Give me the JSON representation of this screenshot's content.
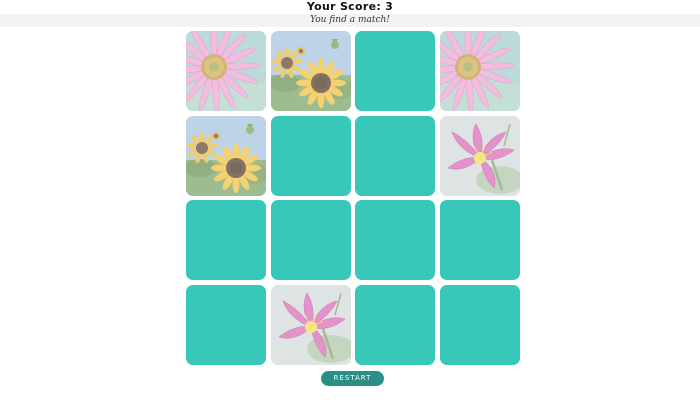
{
  "header": {
    "score_text": "Your Score: 3",
    "message": "You find a match!"
  },
  "board": {
    "rows": 4,
    "cols": 4,
    "hidden_color": "#37c8b9",
    "cards": [
      {
        "state": "revealed",
        "image": "pink-coneflower-image"
      },
      {
        "state": "revealed",
        "image": "sunflowers-image"
      },
      {
        "state": "hidden"
      },
      {
        "state": "revealed",
        "image": "pink-coneflower-image"
      },
      {
        "state": "revealed",
        "image": "sunflowers-image"
      },
      {
        "state": "hidden"
      },
      {
        "state": "hidden"
      },
      {
        "state": "revealed",
        "image": "pink-lily-image"
      },
      {
        "state": "hidden"
      },
      {
        "state": "hidden"
      },
      {
        "state": "hidden"
      },
      {
        "state": "hidden"
      },
      {
        "state": "hidden"
      },
      {
        "state": "revealed",
        "image": "pink-lily-image"
      },
      {
        "state": "hidden"
      },
      {
        "state": "hidden"
      }
    ]
  },
  "controls": {
    "restart_label": "RESTART",
    "restart_color": "#2a8f84"
  }
}
